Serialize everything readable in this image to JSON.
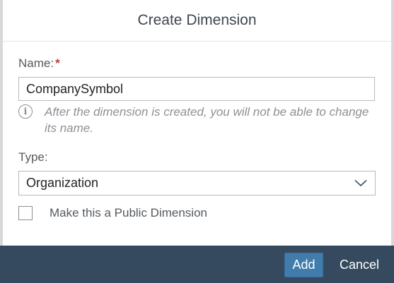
{
  "dialog": {
    "title": "Create Dimension"
  },
  "name_field": {
    "label": "Name:",
    "required_marker": "*",
    "value": "CompanySymbol",
    "info_icon": "info-icon",
    "info_text": "After the dimension is created, you will not be able to change its name."
  },
  "type_field": {
    "label": "Type:",
    "selected": "Organization",
    "chevron_icon": "chevron-down-icon"
  },
  "public_checkbox": {
    "label": "Make this a Public Dimension",
    "checked": false
  },
  "footer": {
    "add_label": "Add",
    "cancel_label": "Cancel"
  },
  "colors": {
    "footer_bg": "#354a5f",
    "primary_button": "#427cac",
    "required": "#bb3d2f"
  }
}
